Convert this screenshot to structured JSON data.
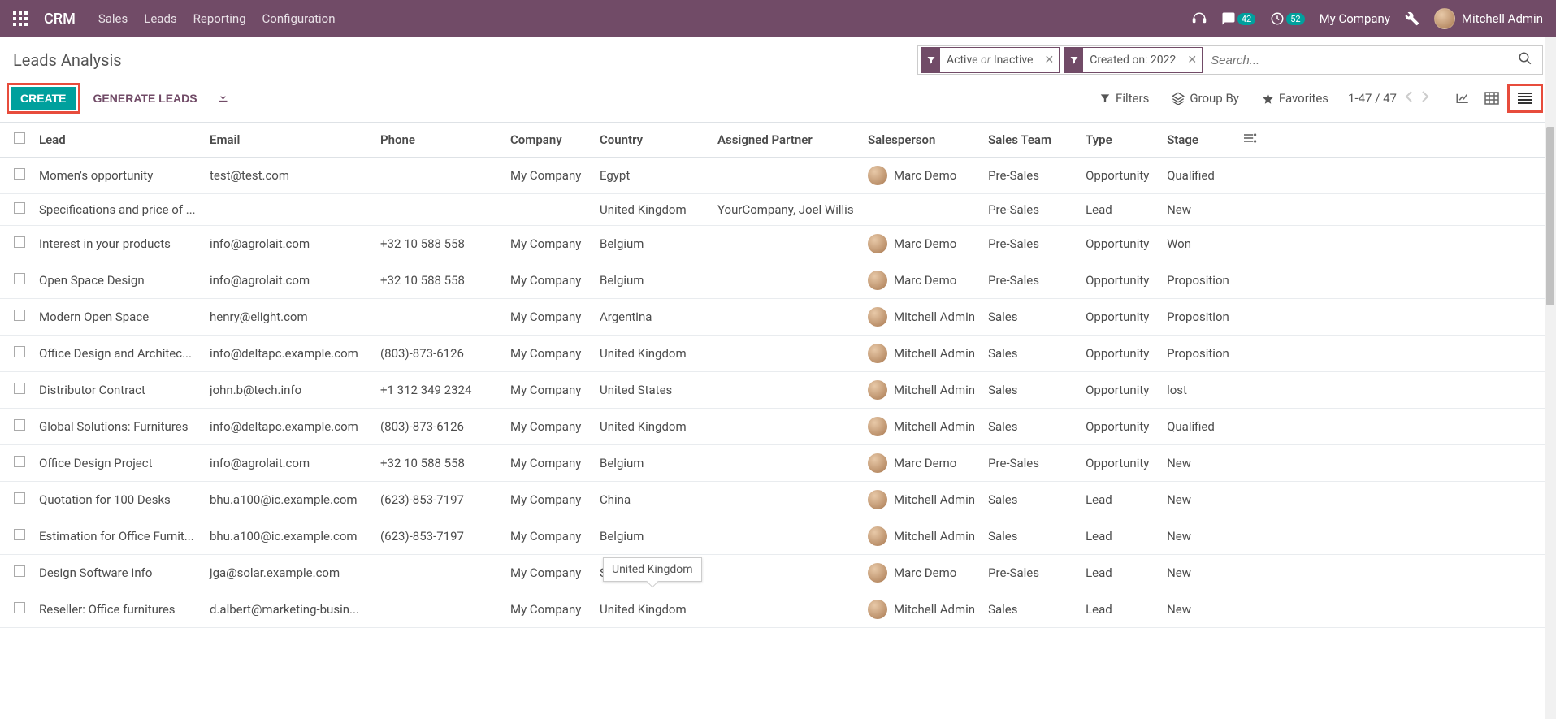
{
  "navbar": {
    "brand": "CRM",
    "menu": [
      "Sales",
      "Leads",
      "Reporting",
      "Configuration"
    ],
    "messages_count": "42",
    "activities_count": "52",
    "company": "My Company",
    "user": "Mitchell Admin"
  },
  "breadcrumb": "Leads Analysis",
  "buttons": {
    "create": "CREATE",
    "generate": "GENERATE LEADS"
  },
  "search": {
    "facets": [
      {
        "label_pre": "Active ",
        "label_em": "or",
        "label_post": " Inactive"
      },
      {
        "label_pre": "Created on: 2022",
        "label_em": "",
        "label_post": ""
      }
    ],
    "placeholder": "Search...",
    "filters": "Filters",
    "groupby": "Group By",
    "favorites": "Favorites"
  },
  "pager": {
    "range": "1-47",
    "sep": " / ",
    "total": "47"
  },
  "columns": [
    "Lead",
    "Email",
    "Phone",
    "Company",
    "Country",
    "Assigned Partner",
    "Salesperson",
    "Sales Team",
    "Type",
    "Stage"
  ],
  "rows": [
    {
      "lead": "Momen's opportunity",
      "email": "test@test.com",
      "phone": "",
      "company": "My Company",
      "country": "Egypt",
      "partner": "",
      "sp": "Marc Demo",
      "team": "Pre-Sales",
      "type": "Opportunity",
      "stage": "Qualified"
    },
    {
      "lead": "Specifications and price of ...",
      "email": "",
      "phone": "",
      "company": "",
      "country": "United Kingdom",
      "partner": "YourCompany, Joel Willis",
      "sp": "",
      "team": "Pre-Sales",
      "type": "Lead",
      "stage": "New"
    },
    {
      "lead": "Interest in your products",
      "email": "info@agrolait.com",
      "phone": "+32 10 588 558",
      "company": "My Company",
      "country": "Belgium",
      "partner": "",
      "sp": "Marc Demo",
      "team": "Pre-Sales",
      "type": "Opportunity",
      "stage": "Won"
    },
    {
      "lead": "Open Space Design",
      "email": "info@agrolait.com",
      "phone": "+32 10 588 558",
      "company": "My Company",
      "country": "Belgium",
      "partner": "",
      "sp": "Marc Demo",
      "team": "Pre-Sales",
      "type": "Opportunity",
      "stage": "Proposition"
    },
    {
      "lead": "Modern Open Space",
      "email": "henry@elight.com",
      "phone": "",
      "company": "My Company",
      "country": "Argentina",
      "partner": "",
      "sp": "Mitchell Admin",
      "team": "Sales",
      "type": "Opportunity",
      "stage": "Proposition"
    },
    {
      "lead": "Office Design and Architec...",
      "email": "info@deltapc.example.com",
      "phone": "(803)-873-6126",
      "company": "My Company",
      "country": "United Kingdom",
      "partner": "",
      "sp": "Mitchell Admin",
      "team": "Sales",
      "type": "Opportunity",
      "stage": "Proposition"
    },
    {
      "lead": "Distributor Contract",
      "email": "john.b@tech.info",
      "phone": "+1 312 349 2324",
      "company": "My Company",
      "country": "United States",
      "partner": "",
      "sp": "Mitchell Admin",
      "team": "Sales",
      "type": "Opportunity",
      "stage": "lost"
    },
    {
      "lead": "Global Solutions: Furnitures",
      "email": "info@deltapc.example.com",
      "phone": "(803)-873-6126",
      "company": "My Company",
      "country": "United Kingdom",
      "partner": "",
      "sp": "Mitchell Admin",
      "team": "Sales",
      "type": "Opportunity",
      "stage": "Qualified"
    },
    {
      "lead": "Office Design Project",
      "email": "info@agrolait.com",
      "phone": "+32 10 588 558",
      "company": "My Company",
      "country": "Belgium",
      "partner": "",
      "sp": "Marc Demo",
      "team": "Pre-Sales",
      "type": "Opportunity",
      "stage": "New"
    },
    {
      "lead": "Quotation for 100 Desks",
      "email": "bhu.a100@ic.example.com",
      "phone": "(623)-853-7197",
      "company": "My Company",
      "country": "China",
      "partner": "",
      "sp": "Mitchell Admin",
      "team": "Sales",
      "type": "Lead",
      "stage": "New"
    },
    {
      "lead": "Estimation for Office Furnit...",
      "email": "bhu.a100@ic.example.com",
      "phone": "(623)-853-7197",
      "company": "My Company",
      "country": "Belgium",
      "partner": "",
      "sp": "Mitchell Admin",
      "team": "Sales",
      "type": "Lead",
      "stage": "New"
    },
    {
      "lead": "Design Software Info",
      "email": "jga@solar.example.com",
      "phone": "",
      "company": "My Company",
      "country": "S",
      "partner": "",
      "sp": "Marc Demo",
      "team": "Pre-Sales",
      "type": "Lead",
      "stage": "New"
    },
    {
      "lead": "Reseller: Office furnitures",
      "email": "d.albert@marketing-busin...",
      "phone": "",
      "company": "My Company",
      "country": "United Kingdom",
      "partner": "",
      "sp": "Mitchell Admin",
      "team": "Sales",
      "type": "Lead",
      "stage": "New"
    }
  ],
  "tooltip": "United Kingdom"
}
